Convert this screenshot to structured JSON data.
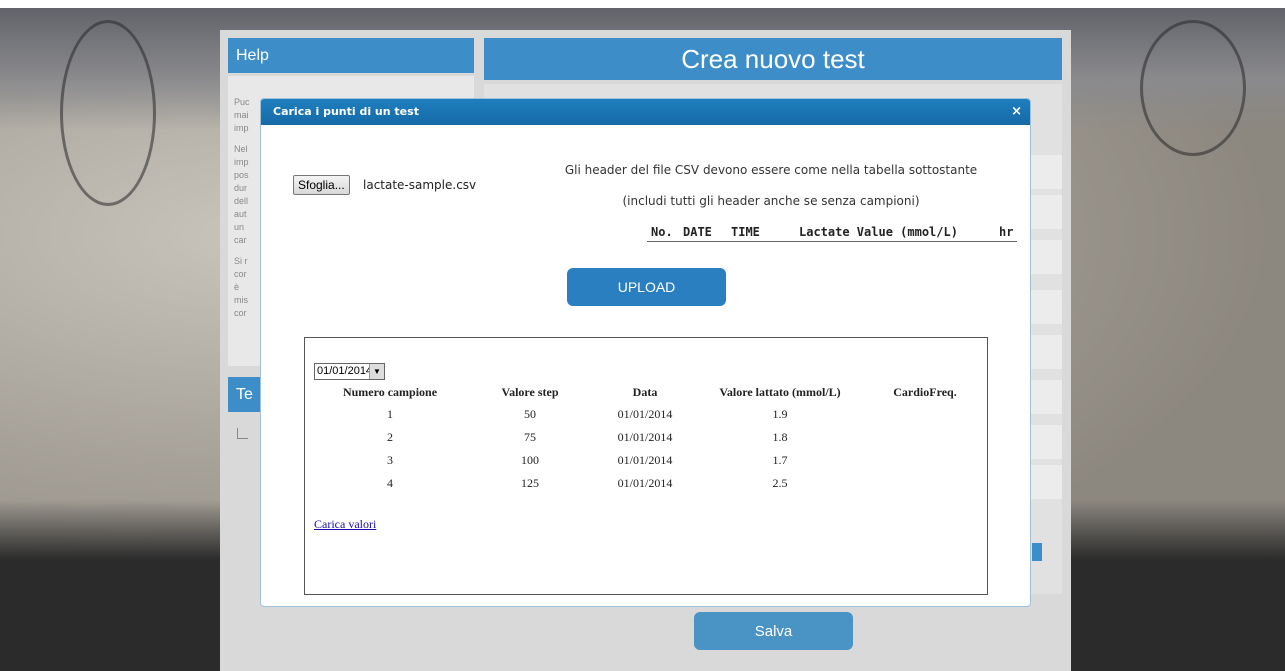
{
  "sidebar": {
    "help_title": "Help",
    "help_fragments": [
      "Puc",
      "mai",
      "imp",
      "Nel",
      "imp",
      "pos",
      "dur",
      "dell",
      "aut",
      "un",
      "car",
      "Si r",
      "cor",
      "è",
      "mis",
      "cor"
    ],
    "test_title": "Te"
  },
  "main": {
    "title": "Crea nuovo test",
    "save_label": "Salva"
  },
  "modal": {
    "title": "Carica i punti di un test",
    "close_label": "×",
    "browse_label": "Sfoglia...",
    "file_name": "lactate-sample.csv",
    "hint_line1": "Gli header del file CSV devono essere come nella tabella sottostante",
    "hint_line2": "(includi tutti gli header anche se senza campioni)",
    "csv_headers": [
      "No.",
      "DATE",
      "TIME",
      "Lactate Value (mmol/L)",
      "hr"
    ],
    "upload_label": "UPLOAD",
    "date_selected": "01/01/2014",
    "table_headers": [
      "Numero campione",
      "Valore step",
      "Data",
      "Valore lattato (mmol/L)",
      "CardioFreq."
    ],
    "rows": [
      [
        "1",
        "50",
        "01/01/2014",
        "1.9",
        ""
      ],
      [
        "2",
        "75",
        "01/01/2014",
        "1.8",
        ""
      ],
      [
        "3",
        "100",
        "01/01/2014",
        "1.7",
        ""
      ],
      [
        "4",
        "125",
        "01/01/2014",
        "2.5",
        ""
      ]
    ],
    "load_values_label": "Carica valori"
  },
  "colors": {
    "accent": "#3d8ec8",
    "modal_header": "#1f7fbe",
    "upload_button": "#2a7fc1"
  }
}
